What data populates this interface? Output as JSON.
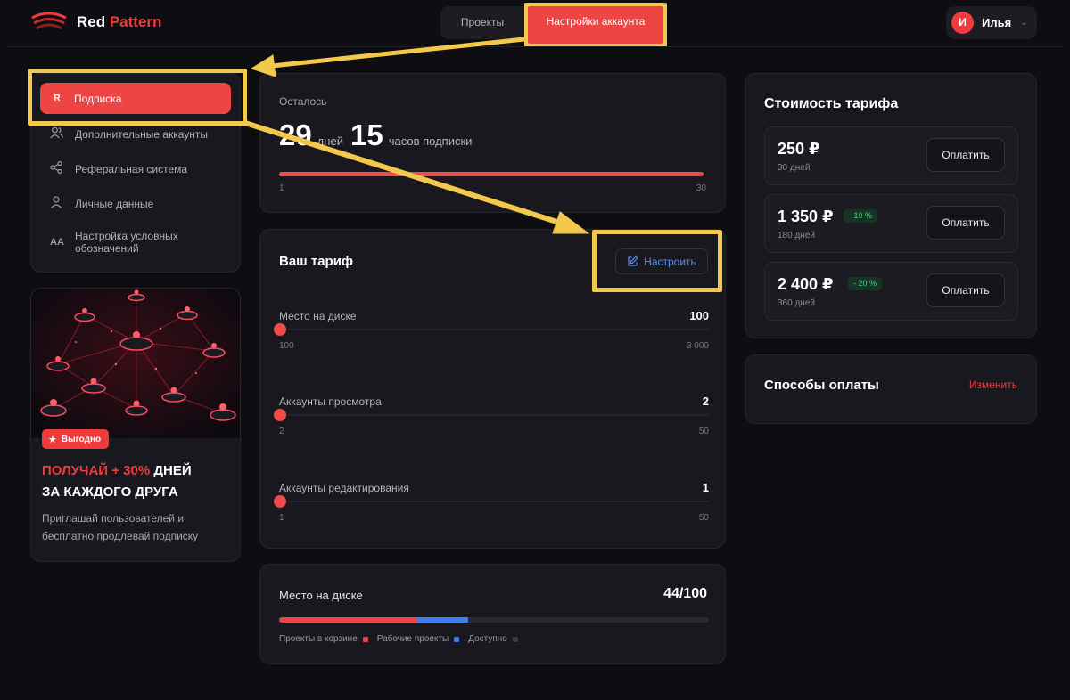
{
  "brand": {
    "part1": "Red",
    "part2": " Pattern"
  },
  "nav": {
    "projects": "Проекты",
    "settings": "Настройки аккаунта"
  },
  "user": {
    "initial": "И",
    "name": "Илья"
  },
  "sidebar": {
    "items": [
      {
        "icon": "R",
        "label": "Подписка"
      },
      {
        "label": "Дополнительные аккаунты"
      },
      {
        "label": "Реферальная система"
      },
      {
        "label": "Личные данные"
      },
      {
        "icon": "AA",
        "label": "Настройка условных обозначений"
      }
    ]
  },
  "promo": {
    "badge": "Выгодно",
    "title_red": "ПОЛУЧАЙ + 30%",
    "title_white1": " ДНЕЙ",
    "title_white2": "ЗА КАЖДОГО ДРУГА",
    "text": "Приглашай пользователей и бесплатно продлевай подписку"
  },
  "remaining": {
    "label": "Осталось",
    "days": "29",
    "days_unit": "дней",
    "hours": "15",
    "hours_unit": "часов подписки",
    "min": "1",
    "max": "30",
    "fraction": 1.0
  },
  "tariff": {
    "title": "Ваш тариф",
    "configure": "Настроить",
    "sliders": [
      {
        "label": "Место на диске",
        "value": "100",
        "min": "100",
        "max": "3 000"
      },
      {
        "label": "Аккаунты просмотра",
        "value": "2",
        "min": "2",
        "max": "50"
      },
      {
        "label": "Аккаунты редактирования",
        "value": "1",
        "min": "1",
        "max": "50"
      }
    ]
  },
  "disk": {
    "title": "Место на диске",
    "value": "44/100",
    "segments": [
      {
        "name": "Проекты в корзине",
        "percent": 32,
        "color": "#ef4444"
      },
      {
        "name": "Рабочие проекты",
        "percent": 12,
        "color": "#3b7cf0"
      },
      {
        "name": "Доступно",
        "percent": 56,
        "color": "#2a2a32"
      }
    ]
  },
  "pricing": {
    "title": "Стоимость тарифа",
    "pay_label": "Оплатить",
    "plans": [
      {
        "price": "250 ₽",
        "days": "30 дней",
        "discount": ""
      },
      {
        "price": "1 350 ₽",
        "days": "180 дней",
        "discount": "- 10 %"
      },
      {
        "price": "2 400 ₽",
        "days": "360 дней",
        "discount": "- 20 %"
      }
    ]
  },
  "payment_methods": {
    "title": "Способы оплаты",
    "change": "Изменить"
  },
  "colors": {
    "accent": "#ef4444",
    "highlight": "#f2c94c",
    "link": "#5b8cf4",
    "success": "#3fd27a"
  }
}
